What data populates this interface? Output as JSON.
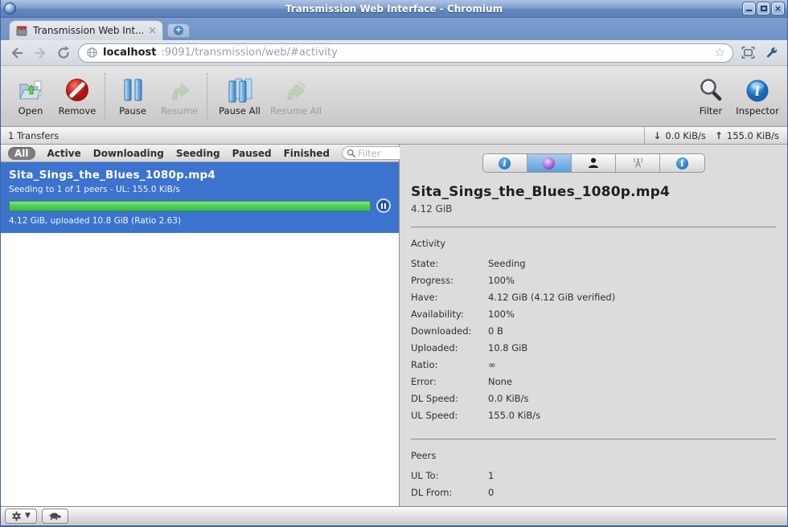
{
  "window": {
    "title": "Transmission Web Interface - Chromium"
  },
  "browser": {
    "tab_title": "Transmission Web Int...",
    "tab_close": "×",
    "url_host": "localhost",
    "url_rest": ":9091/transmission/web/#activity"
  },
  "toolbar": {
    "buttons": [
      {
        "label": "Open",
        "enabled": true
      },
      {
        "label": "Remove",
        "enabled": true
      },
      {
        "label": "Pause",
        "enabled": true
      },
      {
        "label": "Resume",
        "enabled": false
      },
      {
        "label": "Pause All",
        "enabled": true
      },
      {
        "label": "Resume All",
        "enabled": false
      }
    ],
    "filter_label": "Filter",
    "inspector_label": "Inspector"
  },
  "statusbar": {
    "transfers": "1 Transfers",
    "down_arrow": "↓",
    "down_speed": "0.0 KiB/s",
    "up_arrow": "↑",
    "up_speed": "155.0 KiB/s"
  },
  "filterbar": {
    "tabs": [
      {
        "label": "All",
        "selected": true
      },
      {
        "label": "Active",
        "selected": false
      },
      {
        "label": "Downloading",
        "selected": false
      },
      {
        "label": "Seeding",
        "selected": false
      },
      {
        "label": "Paused",
        "selected": false
      },
      {
        "label": "Finished",
        "selected": false
      }
    ],
    "search_placeholder": "Filter"
  },
  "torrent": {
    "name": "Sita_Sings_the_Blues_1080p.mp4",
    "status_line": "Seeding to 1 of 1 peers - UL: 155.0 KiB/s",
    "progress_pct": 100,
    "details_line": "4.12 GiB, uploaded 10.8 GiB (Ratio 2.63)"
  },
  "inspector": {
    "tabs": [
      "info",
      "activity",
      "peers",
      "trackers",
      "files"
    ],
    "selected_tab": "activity",
    "title": "Sita_Sings_the_Blues_1080p.mp4",
    "size": "4.12 GiB",
    "activity_heading": "Activity",
    "activity_rows": [
      {
        "label": "State:",
        "value": "Seeding"
      },
      {
        "label": "Progress:",
        "value": "100%"
      },
      {
        "label": "Have:",
        "value": "4.12 GiB (4.12 GiB verified)"
      },
      {
        "label": "Availability:",
        "value": "100%"
      },
      {
        "label": "Downloaded:",
        "value": "0 B"
      },
      {
        "label": "Uploaded:",
        "value": "10.8 GiB"
      },
      {
        "label": "Ratio:",
        "value": "∞"
      },
      {
        "label": "Error:",
        "value": "None"
      },
      {
        "label": "DL Speed:",
        "value": "0.0 KiB/s"
      },
      {
        "label": "UL Speed:",
        "value": "155.0 KiB/s"
      }
    ],
    "peers_heading": "Peers",
    "peers_rows": [
      {
        "label": "UL To:",
        "value": "1"
      },
      {
        "label": "DL From:",
        "value": "0"
      }
    ]
  },
  "colors": {
    "selection_blue": "#3b73ce",
    "progress_green": "#4fd05a",
    "selected_tab_blue": "#5b9fdb"
  }
}
